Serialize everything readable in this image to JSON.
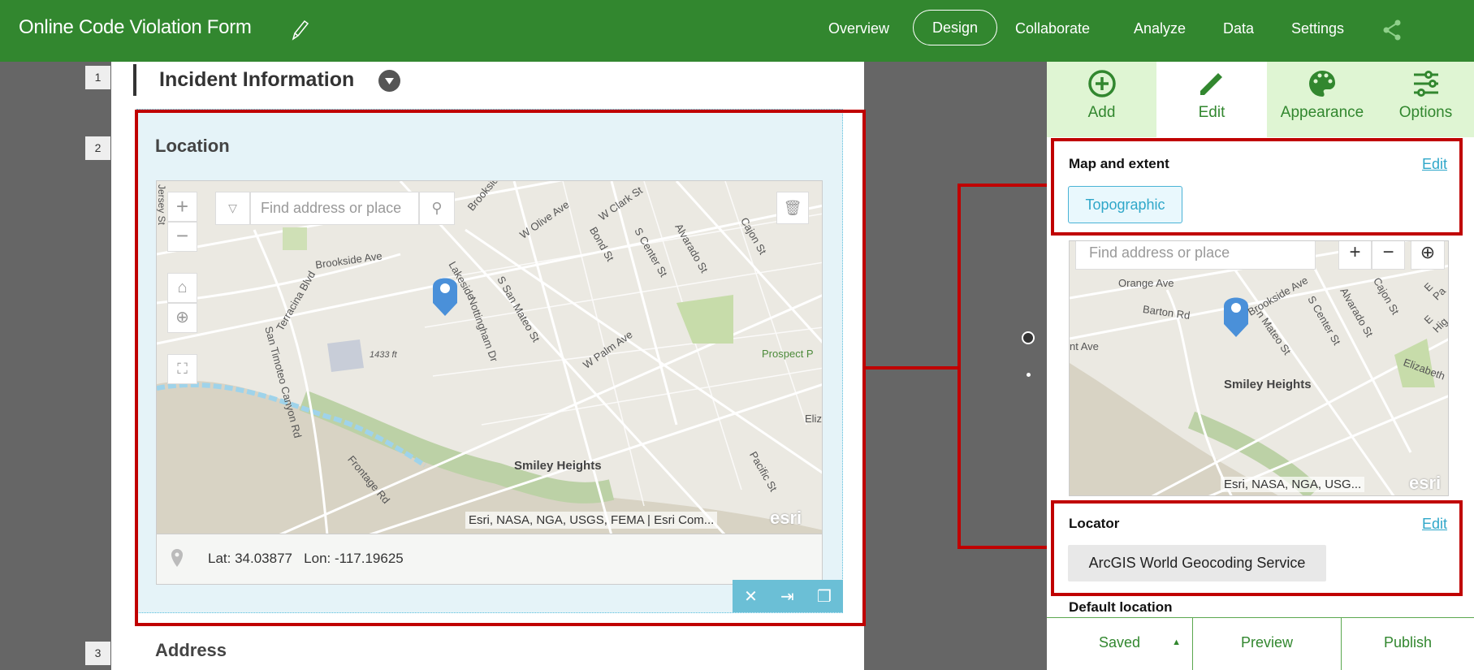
{
  "header": {
    "title": "Online Code Violation Form",
    "nav": [
      "Overview",
      "Design",
      "Collaborate",
      "Analyze",
      "Data",
      "Settings"
    ],
    "active": "Design"
  },
  "form": {
    "rows": [
      {
        "num": "1",
        "label": "Incident Information"
      },
      {
        "num": "2",
        "label": "Location"
      },
      {
        "num": "3",
        "label": "Address"
      }
    ],
    "map": {
      "search_placeholder": "Find address or place",
      "attribution": "Esri, NASA, NGA, USGS, FEMA | Esri Com...",
      "logo": "esri",
      "labels": [
        "W Olive Ave",
        "W Clark St",
        "Bond St",
        "S Center St",
        "Alvarado St",
        "Cajon St",
        "Brookside Ave",
        "Terracina Blvd",
        "Lakeside",
        "Nottingham Dr",
        "S San Mateo St",
        "W Palm Ave",
        "San Timoteo Canyon Rd",
        "1433 ft",
        "Prospect P",
        "Smiley Heights",
        "Frontage Rd",
        "Pacific St",
        "Eliz",
        "Jersey St",
        "Brookside"
      ]
    },
    "latlon": "Lat: 34.03877   Lon: -117.19625"
  },
  "panel": {
    "tabs": [
      {
        "label": "Add",
        "icon": "plus-circle"
      },
      {
        "label": "Edit",
        "icon": "pencil"
      },
      {
        "label": "Appearance",
        "icon": "palette"
      },
      {
        "label": "Options",
        "icon": "sliders"
      }
    ],
    "map_extent": {
      "title": "Map and extent",
      "edit": "Edit",
      "basemap": "Topographic"
    },
    "minimap": {
      "search_placeholder": "Find address or place",
      "attribution": "Esri, NASA, NGA, USG...",
      "logo": "esri",
      "labels": [
        "Orange Ave",
        "Barton Rd",
        "Brookside Ave",
        "S Center St",
        "Alvarado St",
        "Cajon St",
        "E Pa",
        "E Hig",
        "nt Ave",
        "n Mateo St",
        "Smiley Heights",
        "Elizabeth"
      ]
    },
    "locator": {
      "title": "Locator",
      "edit": "Edit",
      "service": "ArcGIS World Geocoding Service"
    },
    "default_location": "Default location",
    "footer": {
      "saved": "Saved",
      "preview": "Preview",
      "publish": "Publish"
    }
  },
  "colors": {
    "brand": "#32872f",
    "highlight": "#c00000",
    "accent": "#2fa7c9"
  }
}
